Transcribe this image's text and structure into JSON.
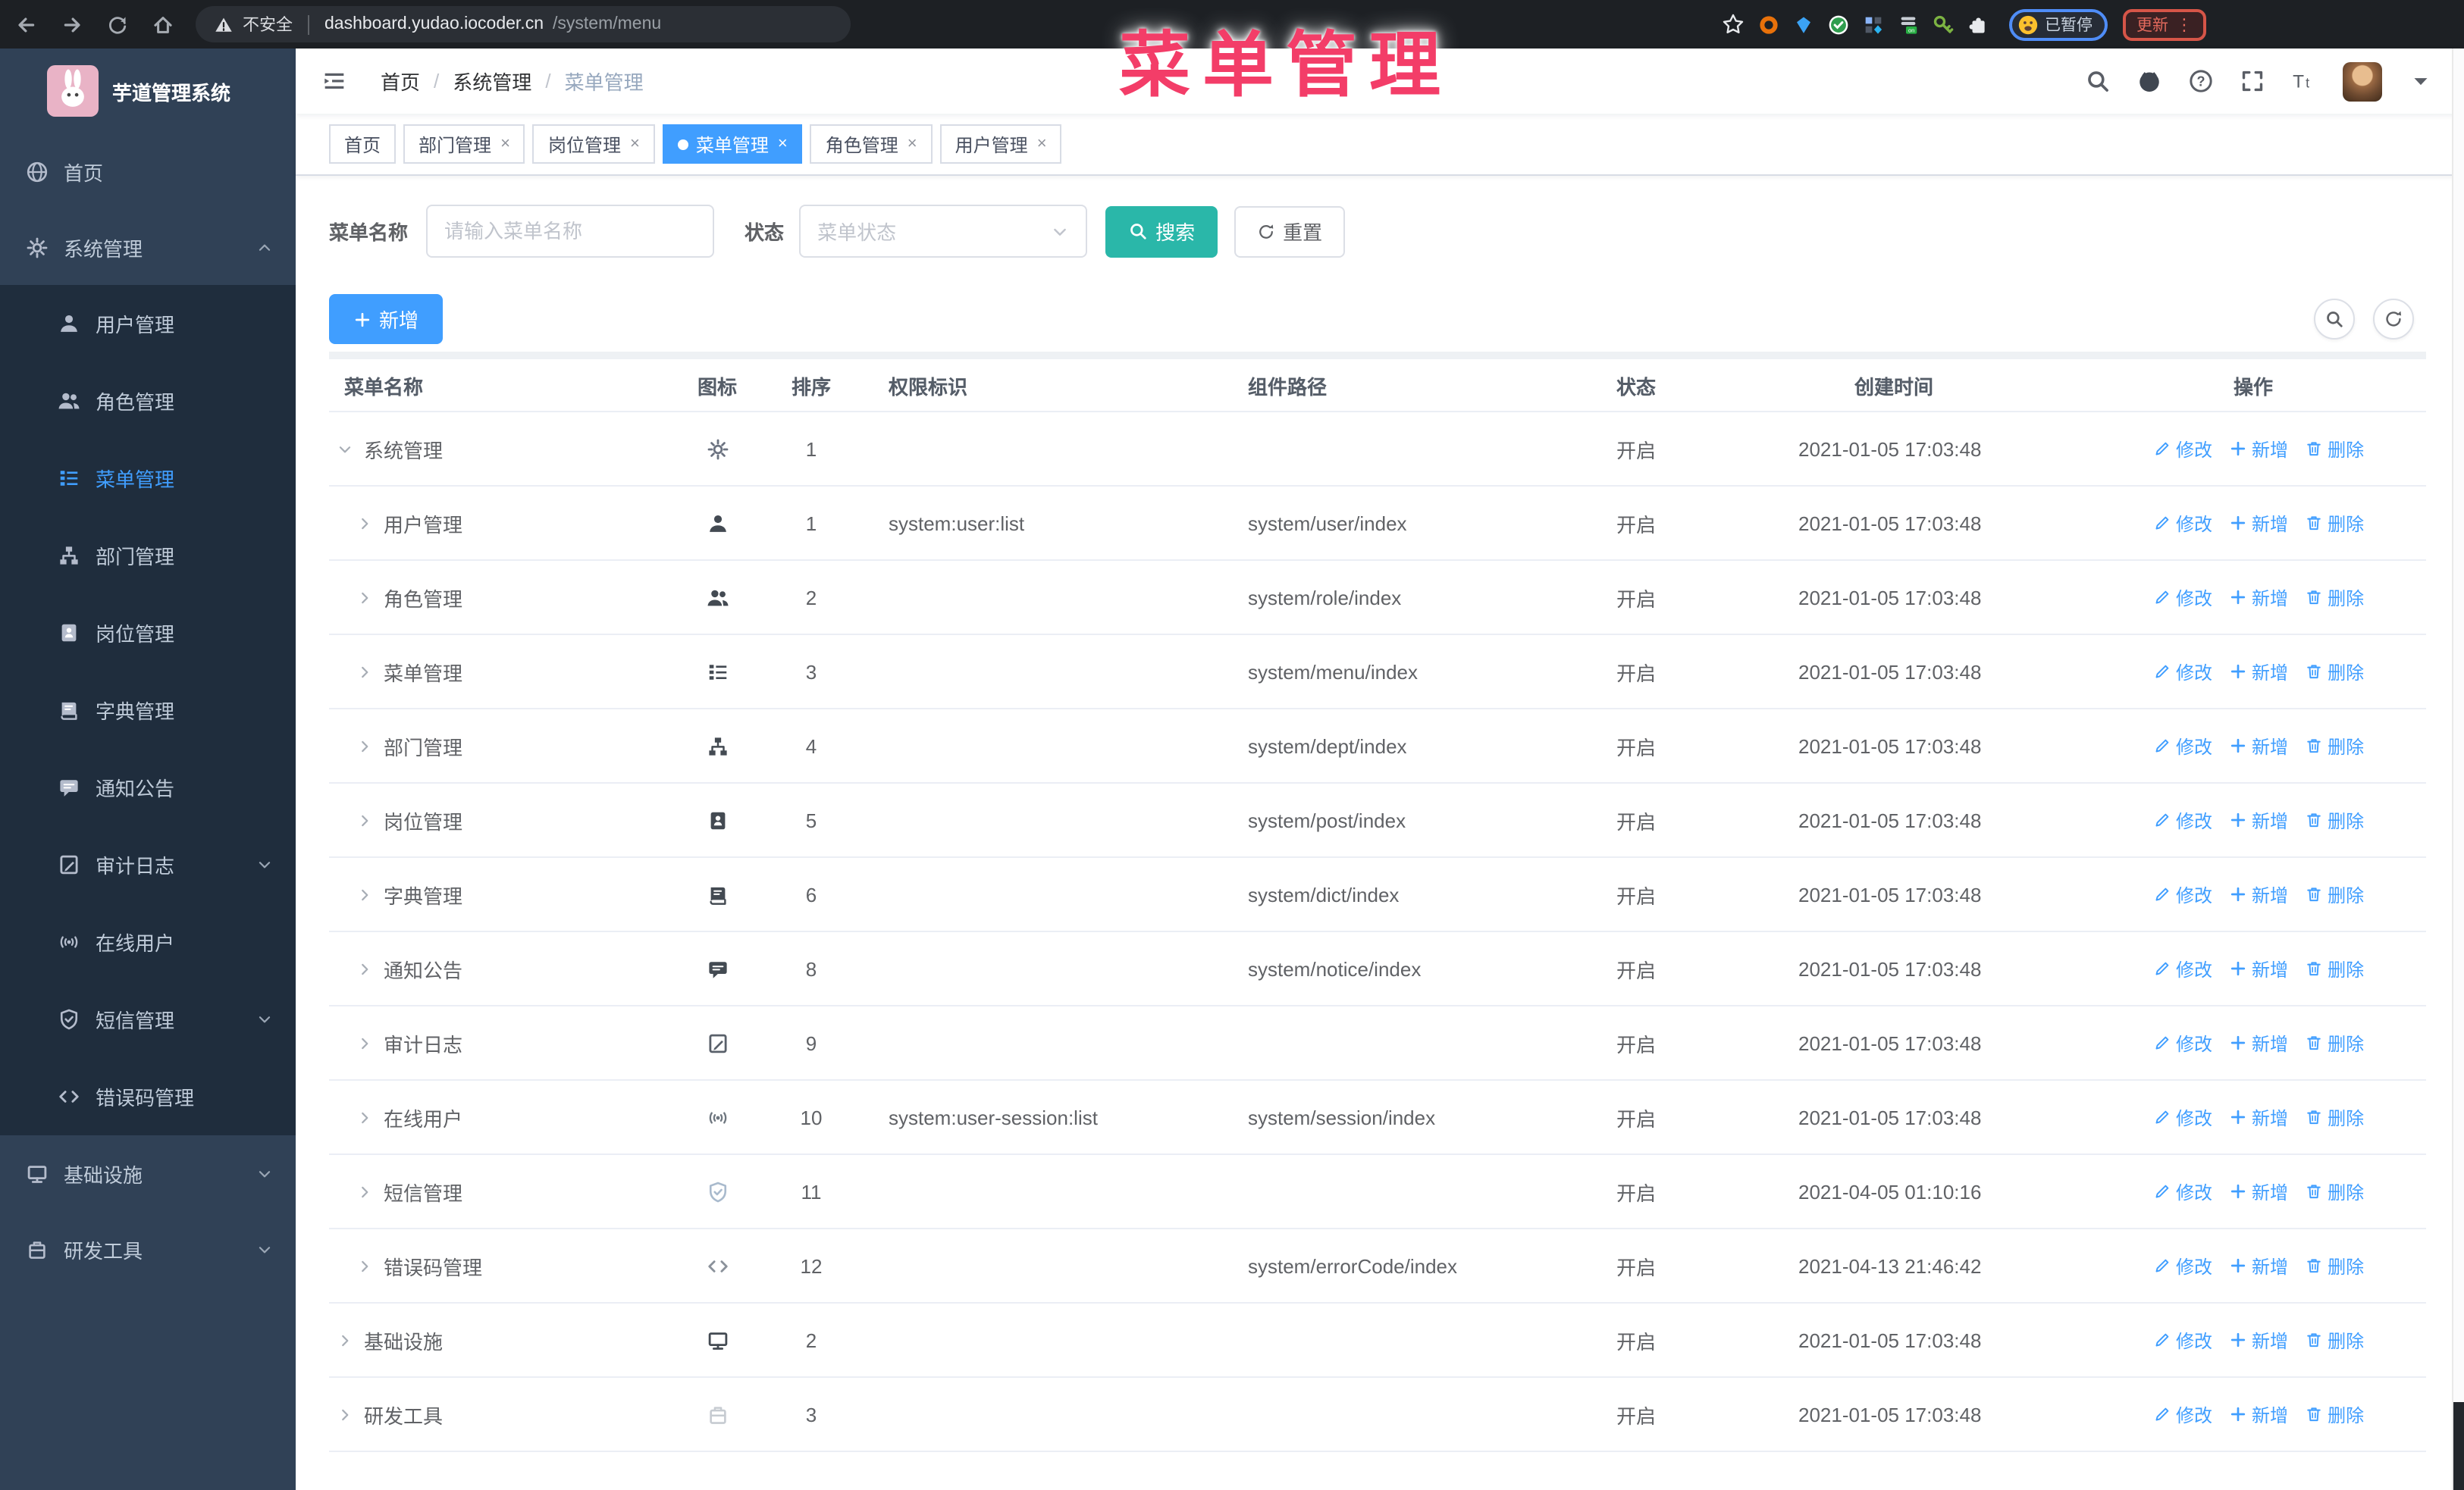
{
  "browser": {
    "security_label": "不安全",
    "url_host": "dashboard.yudao.iocoder.cn",
    "url_path": "/system/menu",
    "nav_icons": [
      "back",
      "forward",
      "reload",
      "home-chrome"
    ],
    "extension_icons": [
      "star",
      "donut",
      "gem",
      "check-circle",
      "grid",
      "on-rows",
      "key",
      "puzzle"
    ],
    "paused_label": "已暂停",
    "update_label": "更新",
    "update_menu_glyph": "⋮"
  },
  "overlay_text": "菜单管理",
  "sidebar": {
    "title": "芋道管理系统",
    "items": [
      {
        "label": "首页",
        "icon": "home",
        "level": 0,
        "active": false,
        "arrow": ""
      },
      {
        "label": "系统管理",
        "icon": "gear",
        "level": 0,
        "active": false,
        "arrow": "up"
      },
      {
        "label": "用户管理",
        "icon": "user",
        "level": 1,
        "active": false,
        "arrow": ""
      },
      {
        "label": "角色管理",
        "icon": "users",
        "level": 1,
        "active": false,
        "arrow": ""
      },
      {
        "label": "菜单管理",
        "icon": "menu",
        "level": 1,
        "active": true,
        "arrow": ""
      },
      {
        "label": "部门管理",
        "icon": "tree",
        "level": 1,
        "active": false,
        "arrow": ""
      },
      {
        "label": "岗位管理",
        "icon": "badge",
        "level": 1,
        "active": false,
        "arrow": ""
      },
      {
        "label": "字典管理",
        "icon": "book",
        "level": 1,
        "active": false,
        "arrow": ""
      },
      {
        "label": "通知公告",
        "icon": "message",
        "level": 1,
        "active": false,
        "arrow": ""
      },
      {
        "label": "审计日志",
        "icon": "form",
        "level": 1,
        "active": false,
        "arrow": "down"
      },
      {
        "label": "在线用户",
        "icon": "online",
        "level": 1,
        "active": false,
        "arrow": ""
      },
      {
        "label": "短信管理",
        "icon": "shield",
        "level": 1,
        "active": false,
        "arrow": "down"
      },
      {
        "label": "错误码管理",
        "icon": "code",
        "level": 1,
        "active": false,
        "arrow": ""
      },
      {
        "label": "基础设施",
        "icon": "monitor",
        "level": 0,
        "active": false,
        "arrow": "down"
      },
      {
        "label": "研发工具",
        "icon": "tool",
        "level": 0,
        "active": false,
        "arrow": "down"
      }
    ]
  },
  "header": {
    "breadcrumb": [
      "首页",
      "系统管理",
      "菜单管理"
    ],
    "icons": [
      "search",
      "github",
      "question",
      "fullscreen",
      "textsize",
      "avatar",
      "caret-down"
    ]
  },
  "tabs": [
    {
      "label": "首页",
      "closable": false,
      "active": false
    },
    {
      "label": "部门管理",
      "closable": true,
      "active": false
    },
    {
      "label": "岗位管理",
      "closable": true,
      "active": false
    },
    {
      "label": "菜单管理",
      "closable": true,
      "active": true
    },
    {
      "label": "角色管理",
      "closable": true,
      "active": false
    },
    {
      "label": "用户管理",
      "closable": true,
      "active": false
    }
  ],
  "filters": {
    "name_label": "菜单名称",
    "name_placeholder": "请输入菜单名称",
    "status_label": "状态",
    "status_placeholder": "菜单状态",
    "search_label": "搜索",
    "reset_label": "重置"
  },
  "toolbar": {
    "add_label": "新增"
  },
  "table": {
    "columns": [
      "菜单名称",
      "图标",
      "排序",
      "权限标识",
      "组件路径",
      "状态",
      "创建时间",
      "操作"
    ],
    "action_labels": {
      "edit": "修改",
      "add": "新增",
      "delete": "删除"
    },
    "rows": [
      {
        "name": "系统管理",
        "level": 0,
        "expanded": true,
        "icon": "gear",
        "icon_color": "#6b7280",
        "sort": "1",
        "perm": "",
        "path": "",
        "status": "开启",
        "time": "2021-01-05 17:03:48"
      },
      {
        "name": "用户管理",
        "level": 1,
        "expanded": false,
        "icon": "user",
        "icon_color": "#434a52",
        "sort": "1",
        "perm": "system:user:list",
        "path": "system/user/index",
        "status": "开启",
        "time": "2021-01-05 17:03:48"
      },
      {
        "name": "角色管理",
        "level": 1,
        "expanded": false,
        "icon": "users",
        "icon_color": "#434a52",
        "sort": "2",
        "perm": "",
        "path": "system/role/index",
        "status": "开启",
        "time": "2021-01-05 17:03:48"
      },
      {
        "name": "菜单管理",
        "level": 1,
        "expanded": false,
        "icon": "menu",
        "icon_color": "#434a52",
        "sort": "3",
        "perm": "",
        "path": "system/menu/index",
        "status": "开启",
        "time": "2021-01-05 17:03:48"
      },
      {
        "name": "部门管理",
        "level": 1,
        "expanded": false,
        "icon": "tree",
        "icon_color": "#434a52",
        "sort": "4",
        "perm": "",
        "path": "system/dept/index",
        "status": "开启",
        "time": "2021-01-05 17:03:48"
      },
      {
        "name": "岗位管理",
        "level": 1,
        "expanded": false,
        "icon": "badge",
        "icon_color": "#434a52",
        "sort": "5",
        "perm": "",
        "path": "system/post/index",
        "status": "开启",
        "time": "2021-01-05 17:03:48"
      },
      {
        "name": "字典管理",
        "level": 1,
        "expanded": false,
        "icon": "book",
        "icon_color": "#434a52",
        "sort": "6",
        "perm": "",
        "path": "system/dict/index",
        "status": "开启",
        "time": "2021-01-05 17:03:48"
      },
      {
        "name": "通知公告",
        "level": 1,
        "expanded": false,
        "icon": "message",
        "icon_color": "#434a52",
        "sort": "8",
        "perm": "",
        "path": "system/notice/index",
        "status": "开启",
        "time": "2021-01-05 17:03:48"
      },
      {
        "name": "审计日志",
        "level": 1,
        "expanded": false,
        "icon": "form",
        "icon_color": "#59606a",
        "sort": "9",
        "perm": "",
        "path": "",
        "status": "开启",
        "time": "2021-01-05 17:03:48"
      },
      {
        "name": "在线用户",
        "level": 1,
        "expanded": false,
        "icon": "online",
        "icon_color": "#6e767f",
        "sort": "10",
        "perm": "system:user-session:list",
        "path": "system/session/index",
        "status": "开启",
        "time": "2021-01-05 17:03:48"
      },
      {
        "name": "短信管理",
        "level": 1,
        "expanded": false,
        "icon": "shield",
        "icon_color": "#a9bacd",
        "sort": "11",
        "perm": "",
        "path": "",
        "status": "开启",
        "time": "2021-04-05 01:10:16"
      },
      {
        "name": "错误码管理",
        "level": 1,
        "expanded": false,
        "icon": "code",
        "icon_color": "#8a919a",
        "sort": "12",
        "perm": "",
        "path": "system/errorCode/index",
        "status": "开启",
        "time": "2021-04-13 21:46:42"
      },
      {
        "name": "基础设施",
        "level": 0,
        "expanded": false,
        "icon": "monitor",
        "icon_color": "#434a52",
        "sort": "2",
        "perm": "",
        "path": "",
        "status": "开启",
        "time": "2021-01-05 17:03:48"
      },
      {
        "name": "研发工具",
        "level": 0,
        "expanded": false,
        "icon": "tool",
        "icon_color": "#c6cbd1",
        "sort": "3",
        "perm": "",
        "path": "",
        "status": "开启",
        "time": "2021-01-05 17:03:48"
      }
    ]
  },
  "colors": {
    "accent": "#409eff",
    "search_button": "#2ab7a9",
    "overlay": "#f33d68",
    "sidebar_bg": "#304156",
    "submenu_bg": "#1f2d3d"
  }
}
